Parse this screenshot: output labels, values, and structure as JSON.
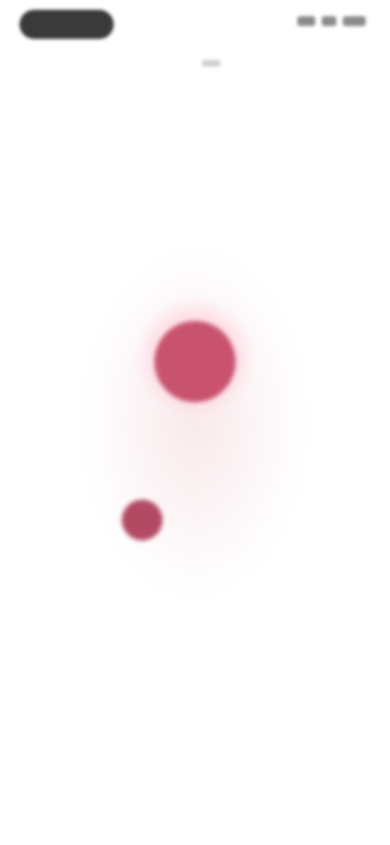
{
  "status_bar": {
    "time": "",
    "icons": [
      "signal-icon",
      "wifi-icon",
      "battery-icon"
    ]
  },
  "caller": {
    "name": "",
    "subtitle": "",
    "avatar_initial": ""
  },
  "action": {
    "label": "",
    "detail": ""
  },
  "colors": {
    "accent": "#c9536f",
    "accent_dark": "#b24a63",
    "background": "#ffffff"
  }
}
